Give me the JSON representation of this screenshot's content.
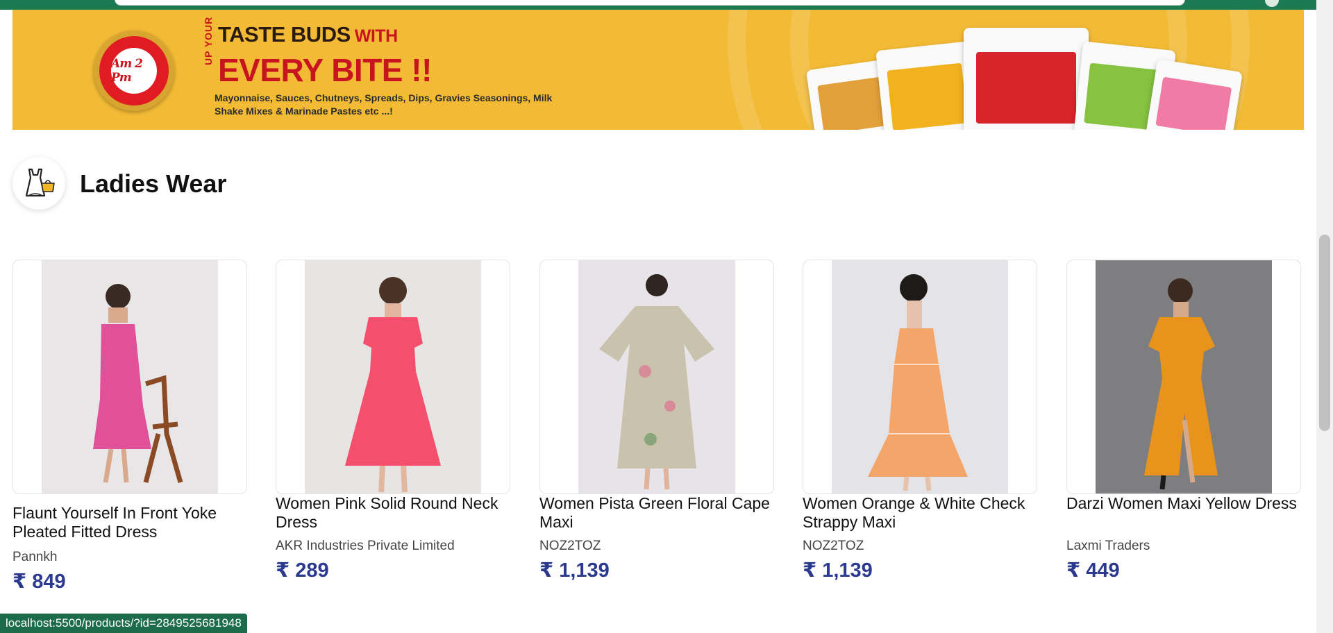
{
  "banner": {
    "brand_logo_text": "Am 2 Pm",
    "up_your": "UP YOUR",
    "headline_1": "TASTE BUDS",
    "headline_with": "WITH",
    "headline_2": "EVERY BITE !!",
    "tagline": "Mayonnaise, Sauces, Chutneys, Spreads, Dips, Gravies Seasonings, Milk Shake Mixes & Marinade Pastes etc ...!"
  },
  "section": {
    "icon": "dress-shopping-bag-icon",
    "title": "Ladies Wear"
  },
  "products": [
    {
      "title": "Flaunt Yourself In Front Yoke Pleated Fitted Dress",
      "seller": "Pannkh",
      "price": "₹ 849",
      "color": "#e0519a"
    },
    {
      "title": "Women Pink Solid Round Neck Dress",
      "seller": "AKR Industries Private Limited",
      "price": "₹ 289",
      "color": "#f4506e"
    },
    {
      "title": "Women Pista Green Floral Cape Maxi",
      "seller": "NOZ2TOZ",
      "price": "₹ 1,139",
      "color": "#c9c3ad"
    },
    {
      "title": "Women Orange & White Check Strappy Maxi",
      "seller": "NOZ2TOZ",
      "price": "₹ 1,139",
      "color": "#f3a56a"
    },
    {
      "title": "Darzi Women Maxi Yellow Dress",
      "seller": "Laxmi Traders",
      "price": "₹ 449",
      "color": "#e8931c"
    }
  ],
  "status_url": "localhost:5500/products/?id=2849525681948",
  "colors": {
    "header_green": "#1c7a52",
    "banner_yellow": "#f3bb35",
    "brand_red": "#c8141e",
    "price_blue": "#2b3a8f"
  }
}
